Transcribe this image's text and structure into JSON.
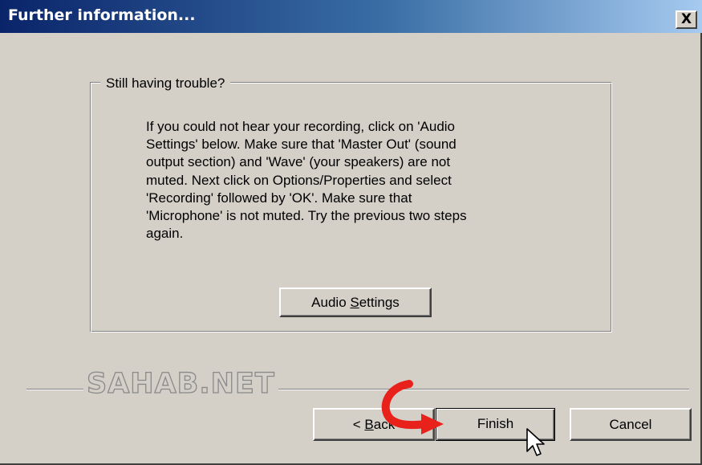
{
  "window": {
    "title": "Further information...",
    "close_glyph": "X"
  },
  "group": {
    "legend": "Still having trouble?",
    "message": "If you could not hear your recording, click on 'Audio\nSettings' below.  Make sure that 'Master Out' (sound\noutput section) and 'Wave' (your speakers) are not\nmuted.  Next click on Options/Properties and select\n'Recording' followed by 'OK'.  Make sure that\n'Microphone' is not muted.  Try the previous two steps\nagain.",
    "audio_button": {
      "pre": "Audio ",
      "mnemonic": "S",
      "post": "ettings"
    }
  },
  "watermark": "SAHAB.NET",
  "buttons": {
    "back": {
      "pre": "< ",
      "mnemonic": "B",
      "post": "ack"
    },
    "finish": "Finish",
    "cancel": "Cancel"
  },
  "icons": {
    "arrow": "red-curved-arrow-icon",
    "cursor": "mouse-pointer-icon"
  },
  "colors": {
    "face": "#d4d0c8",
    "title_start": "#0a246a",
    "title_end": "#a6caf0",
    "arrow": "#e8221b"
  }
}
